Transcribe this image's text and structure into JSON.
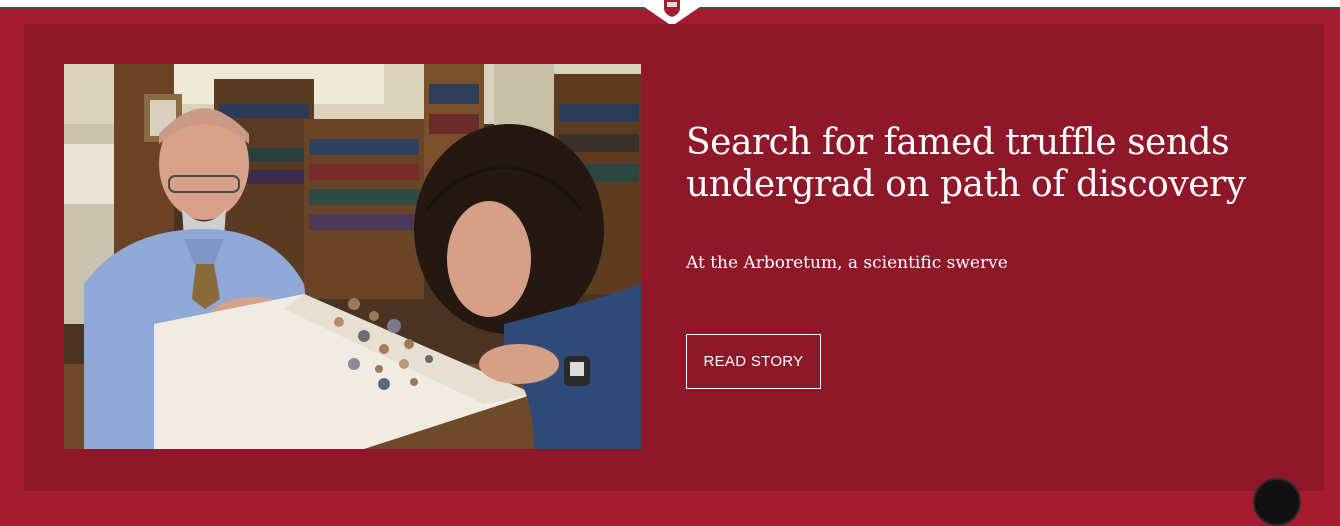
{
  "story": {
    "headline": "Search for famed truffle sends undergrad on path of discovery",
    "subhead": "At the Arboretum, a scientific swerve",
    "cta_label": "READ STORY",
    "photo_alt": "Library photograph"
  },
  "icons": {
    "shield": "shield-icon",
    "scroll_top": "scroll-top-icon"
  },
  "colors": {
    "outer_background": "#a51c30",
    "panel_background": "#8e1729",
    "text": "#ffffff"
  }
}
